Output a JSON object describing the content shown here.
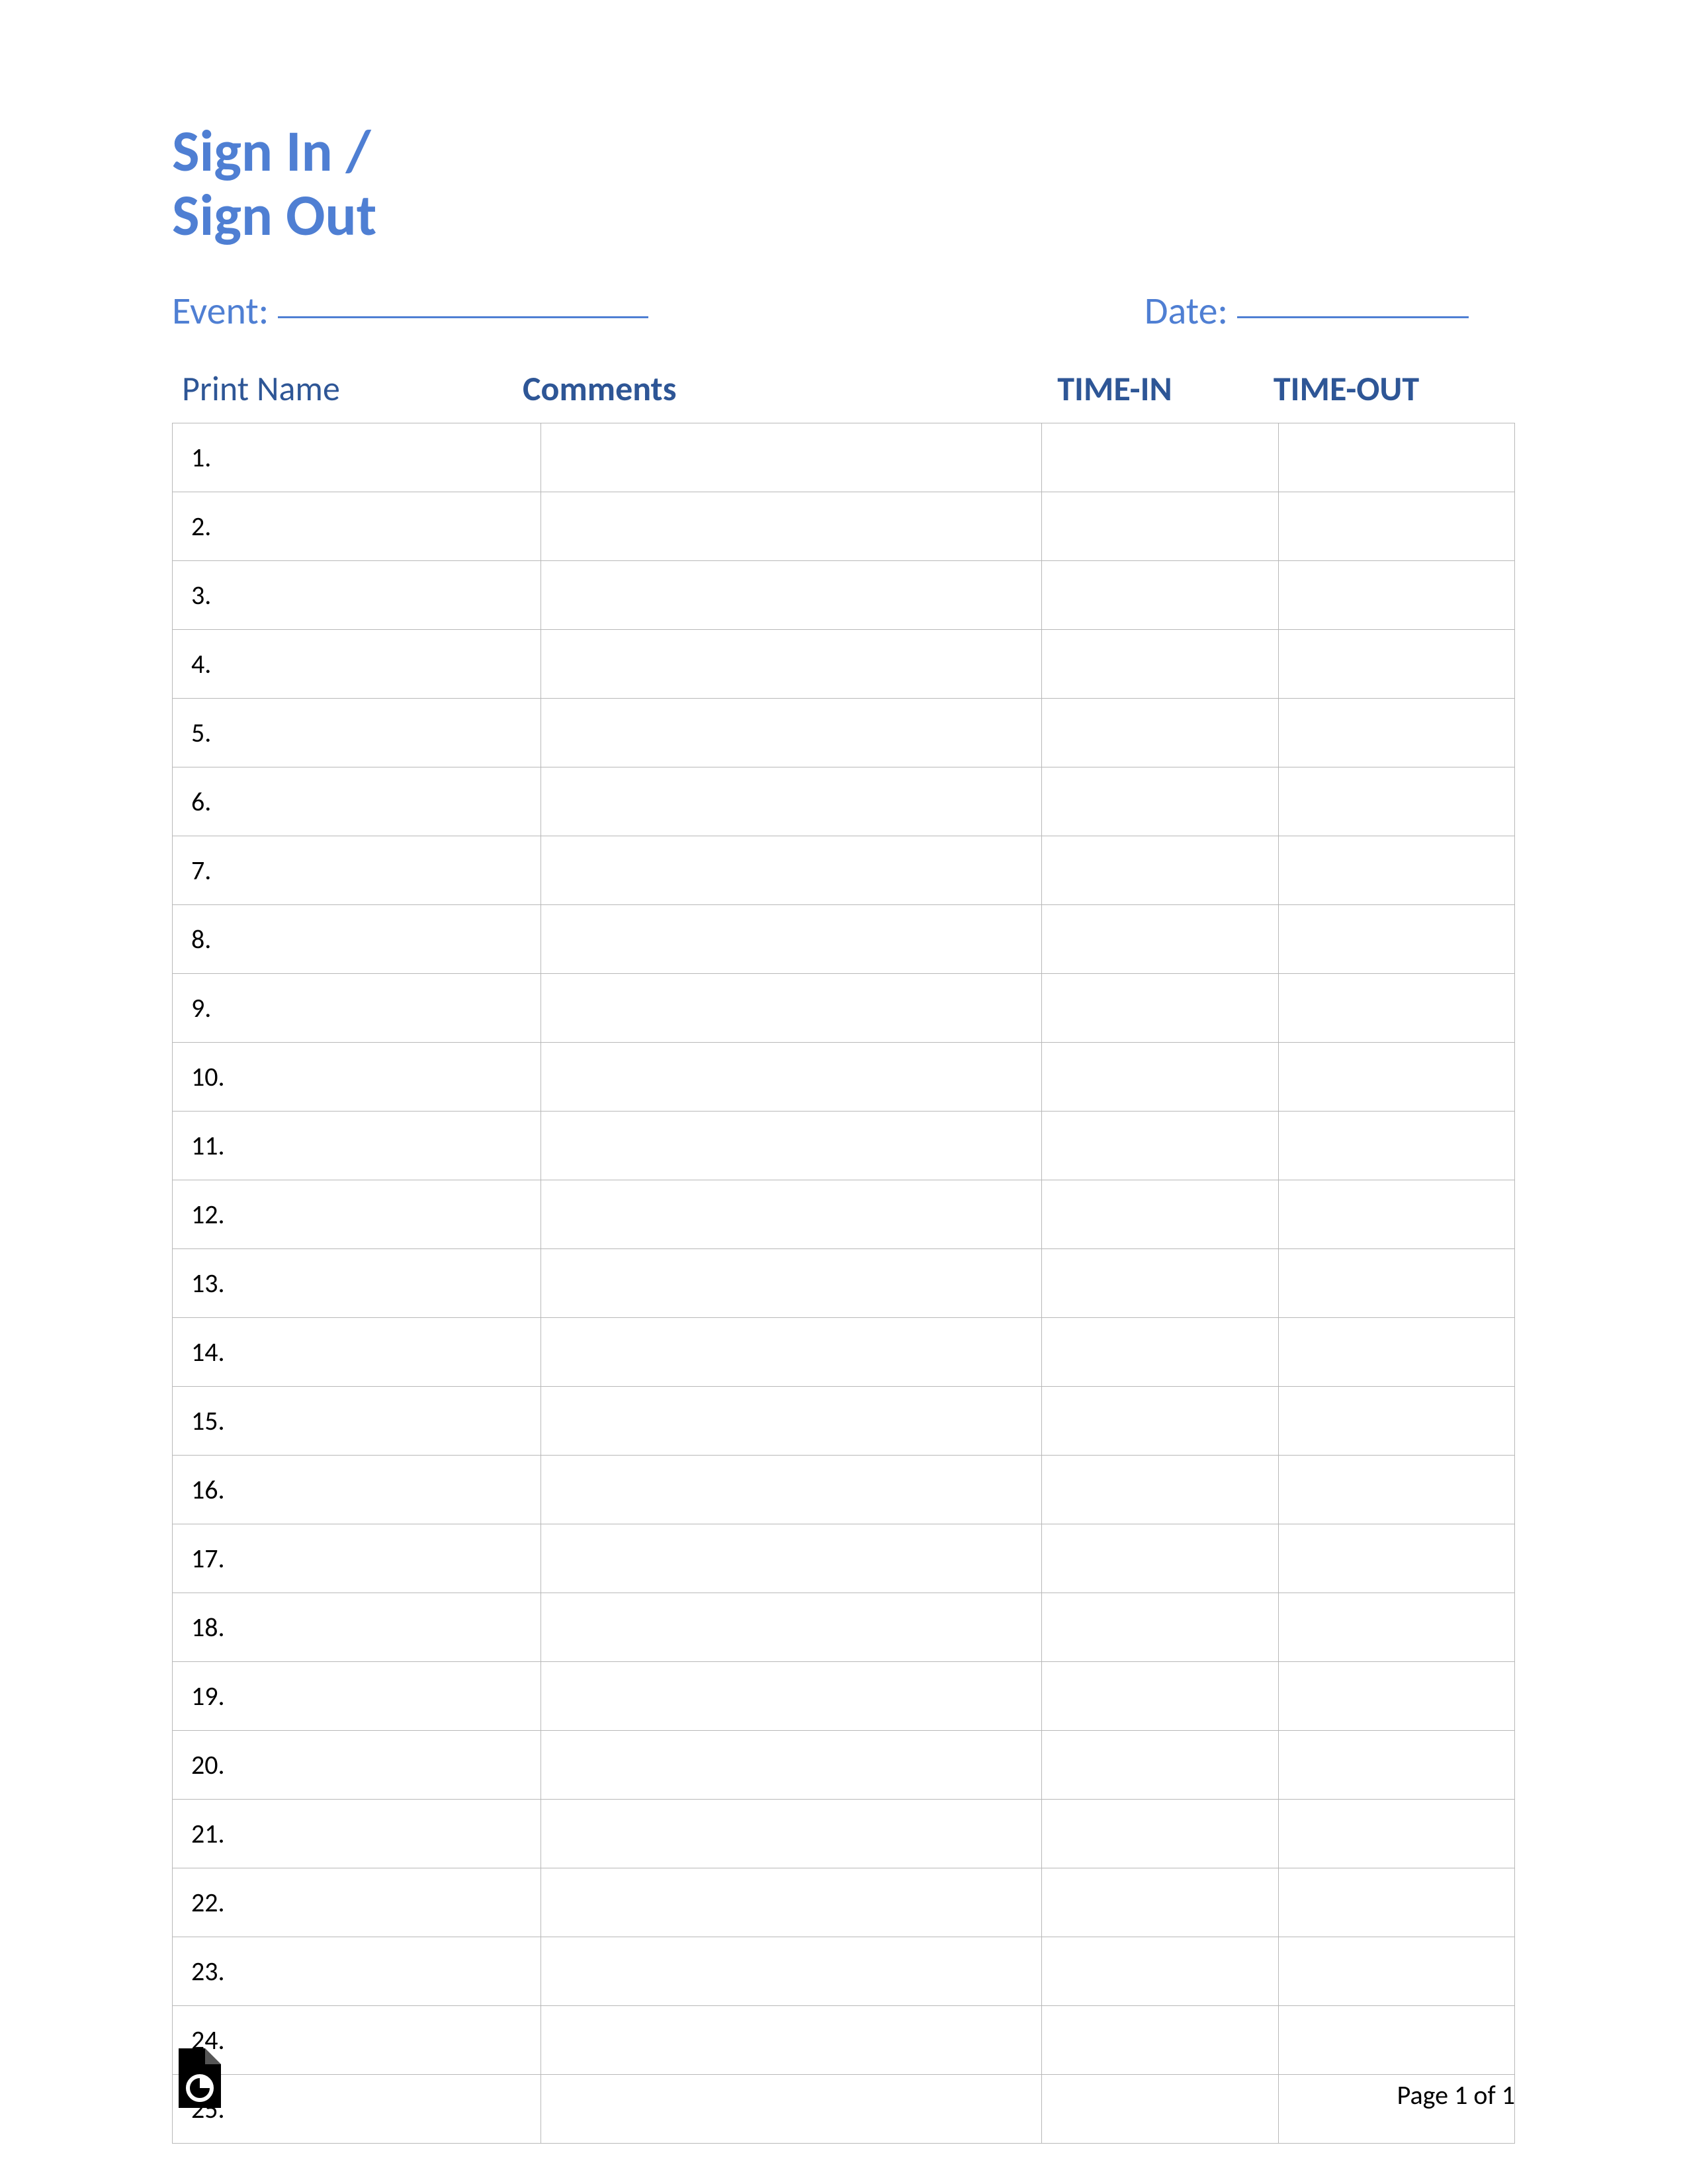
{
  "title": {
    "line1": "Sign In /",
    "line2": "Sign Out"
  },
  "meta": {
    "event_label": "Event:",
    "date_label": "Date:"
  },
  "headers": {
    "name": "Print Name",
    "comments": "Comments",
    "timein": "TIME-IN",
    "timeout": "TIME-OUT"
  },
  "rows": [
    {
      "num": "1."
    },
    {
      "num": "2."
    },
    {
      "num": "3."
    },
    {
      "num": "4."
    },
    {
      "num": "5."
    },
    {
      "num": "6."
    },
    {
      "num": "7."
    },
    {
      "num": "8."
    },
    {
      "num": "9."
    },
    {
      "num": "10."
    },
    {
      "num": "11."
    },
    {
      "num": "12."
    },
    {
      "num": "13."
    },
    {
      "num": "14."
    },
    {
      "num": "15."
    },
    {
      "num": "16."
    },
    {
      "num": "17."
    },
    {
      "num": "18."
    },
    {
      "num": "19."
    },
    {
      "num": "20."
    },
    {
      "num": "21."
    },
    {
      "num": "22."
    },
    {
      "num": "23."
    },
    {
      "num": "24."
    },
    {
      "num": "25."
    }
  ],
  "footer": {
    "page": "Page 1 of 1"
  }
}
